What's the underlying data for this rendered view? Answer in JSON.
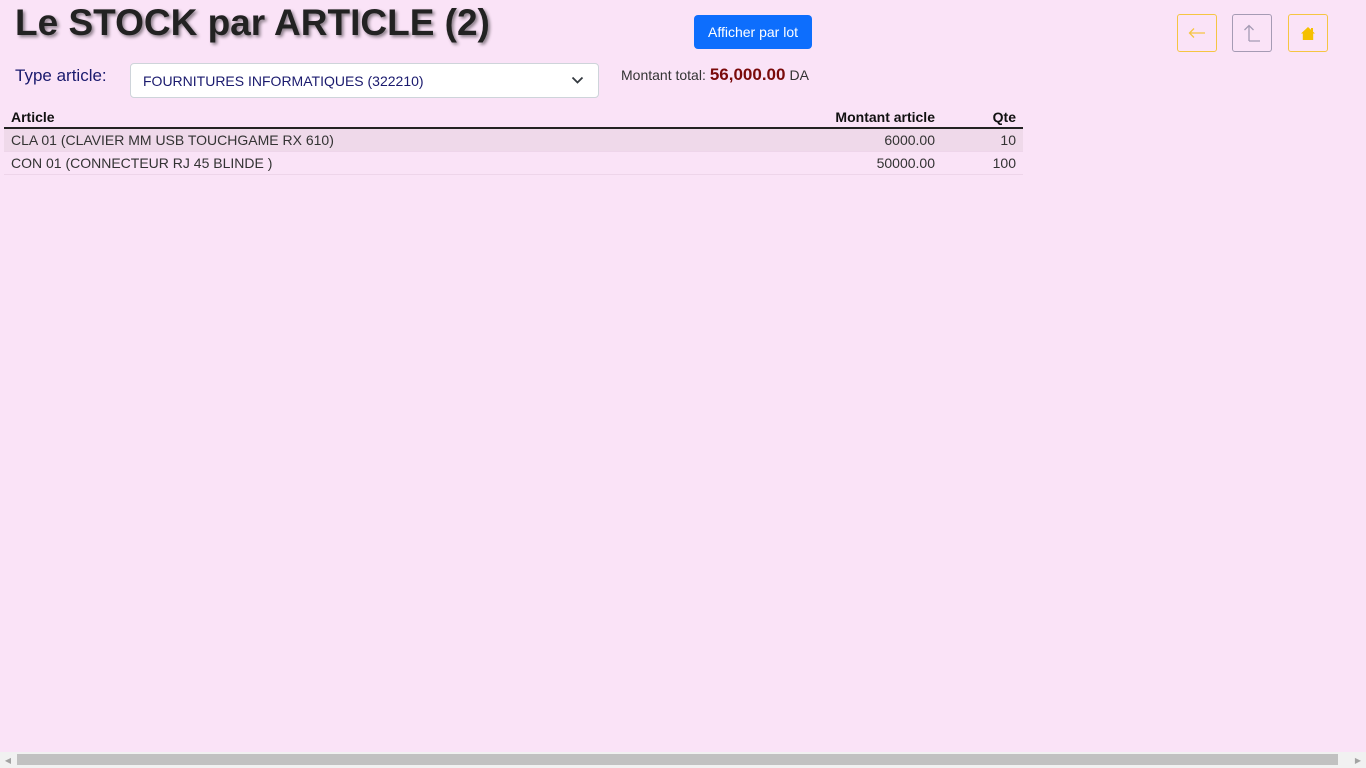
{
  "header": {
    "title": "Le STOCK par ARTICLE (2)",
    "lot_button_label": "Afficher par lot"
  },
  "nav": {
    "back_icon": "arrow-left-icon",
    "up_icon": "arrow-up-icon",
    "home_icon": "home-icon"
  },
  "filter": {
    "type_label": "Type article:",
    "type_selected": "FOURNITURES INFORMATIQUES (322210)"
  },
  "total": {
    "label": "Montant total:",
    "value": "56,000.00",
    "unit": "DA"
  },
  "table": {
    "headers": {
      "article": "Article",
      "montant": "Montant article",
      "qte": "Qte"
    },
    "rows": [
      {
        "article": "CLA 01 (CLAVIER MM USB TOUCHGAME RX 610)",
        "montant": "6000.00",
        "qte": "10"
      },
      {
        "article": "CON 01 (CONNECTEUR RJ 45 BLINDE )",
        "montant": "50000.00",
        "qte": "100"
      }
    ]
  },
  "colors": {
    "background": "#fae3f7",
    "primary_button": "#0d6efd",
    "nav_accent": "#f5c542",
    "total_value": "#7a0a0a",
    "label_text": "#1a1a6e"
  }
}
